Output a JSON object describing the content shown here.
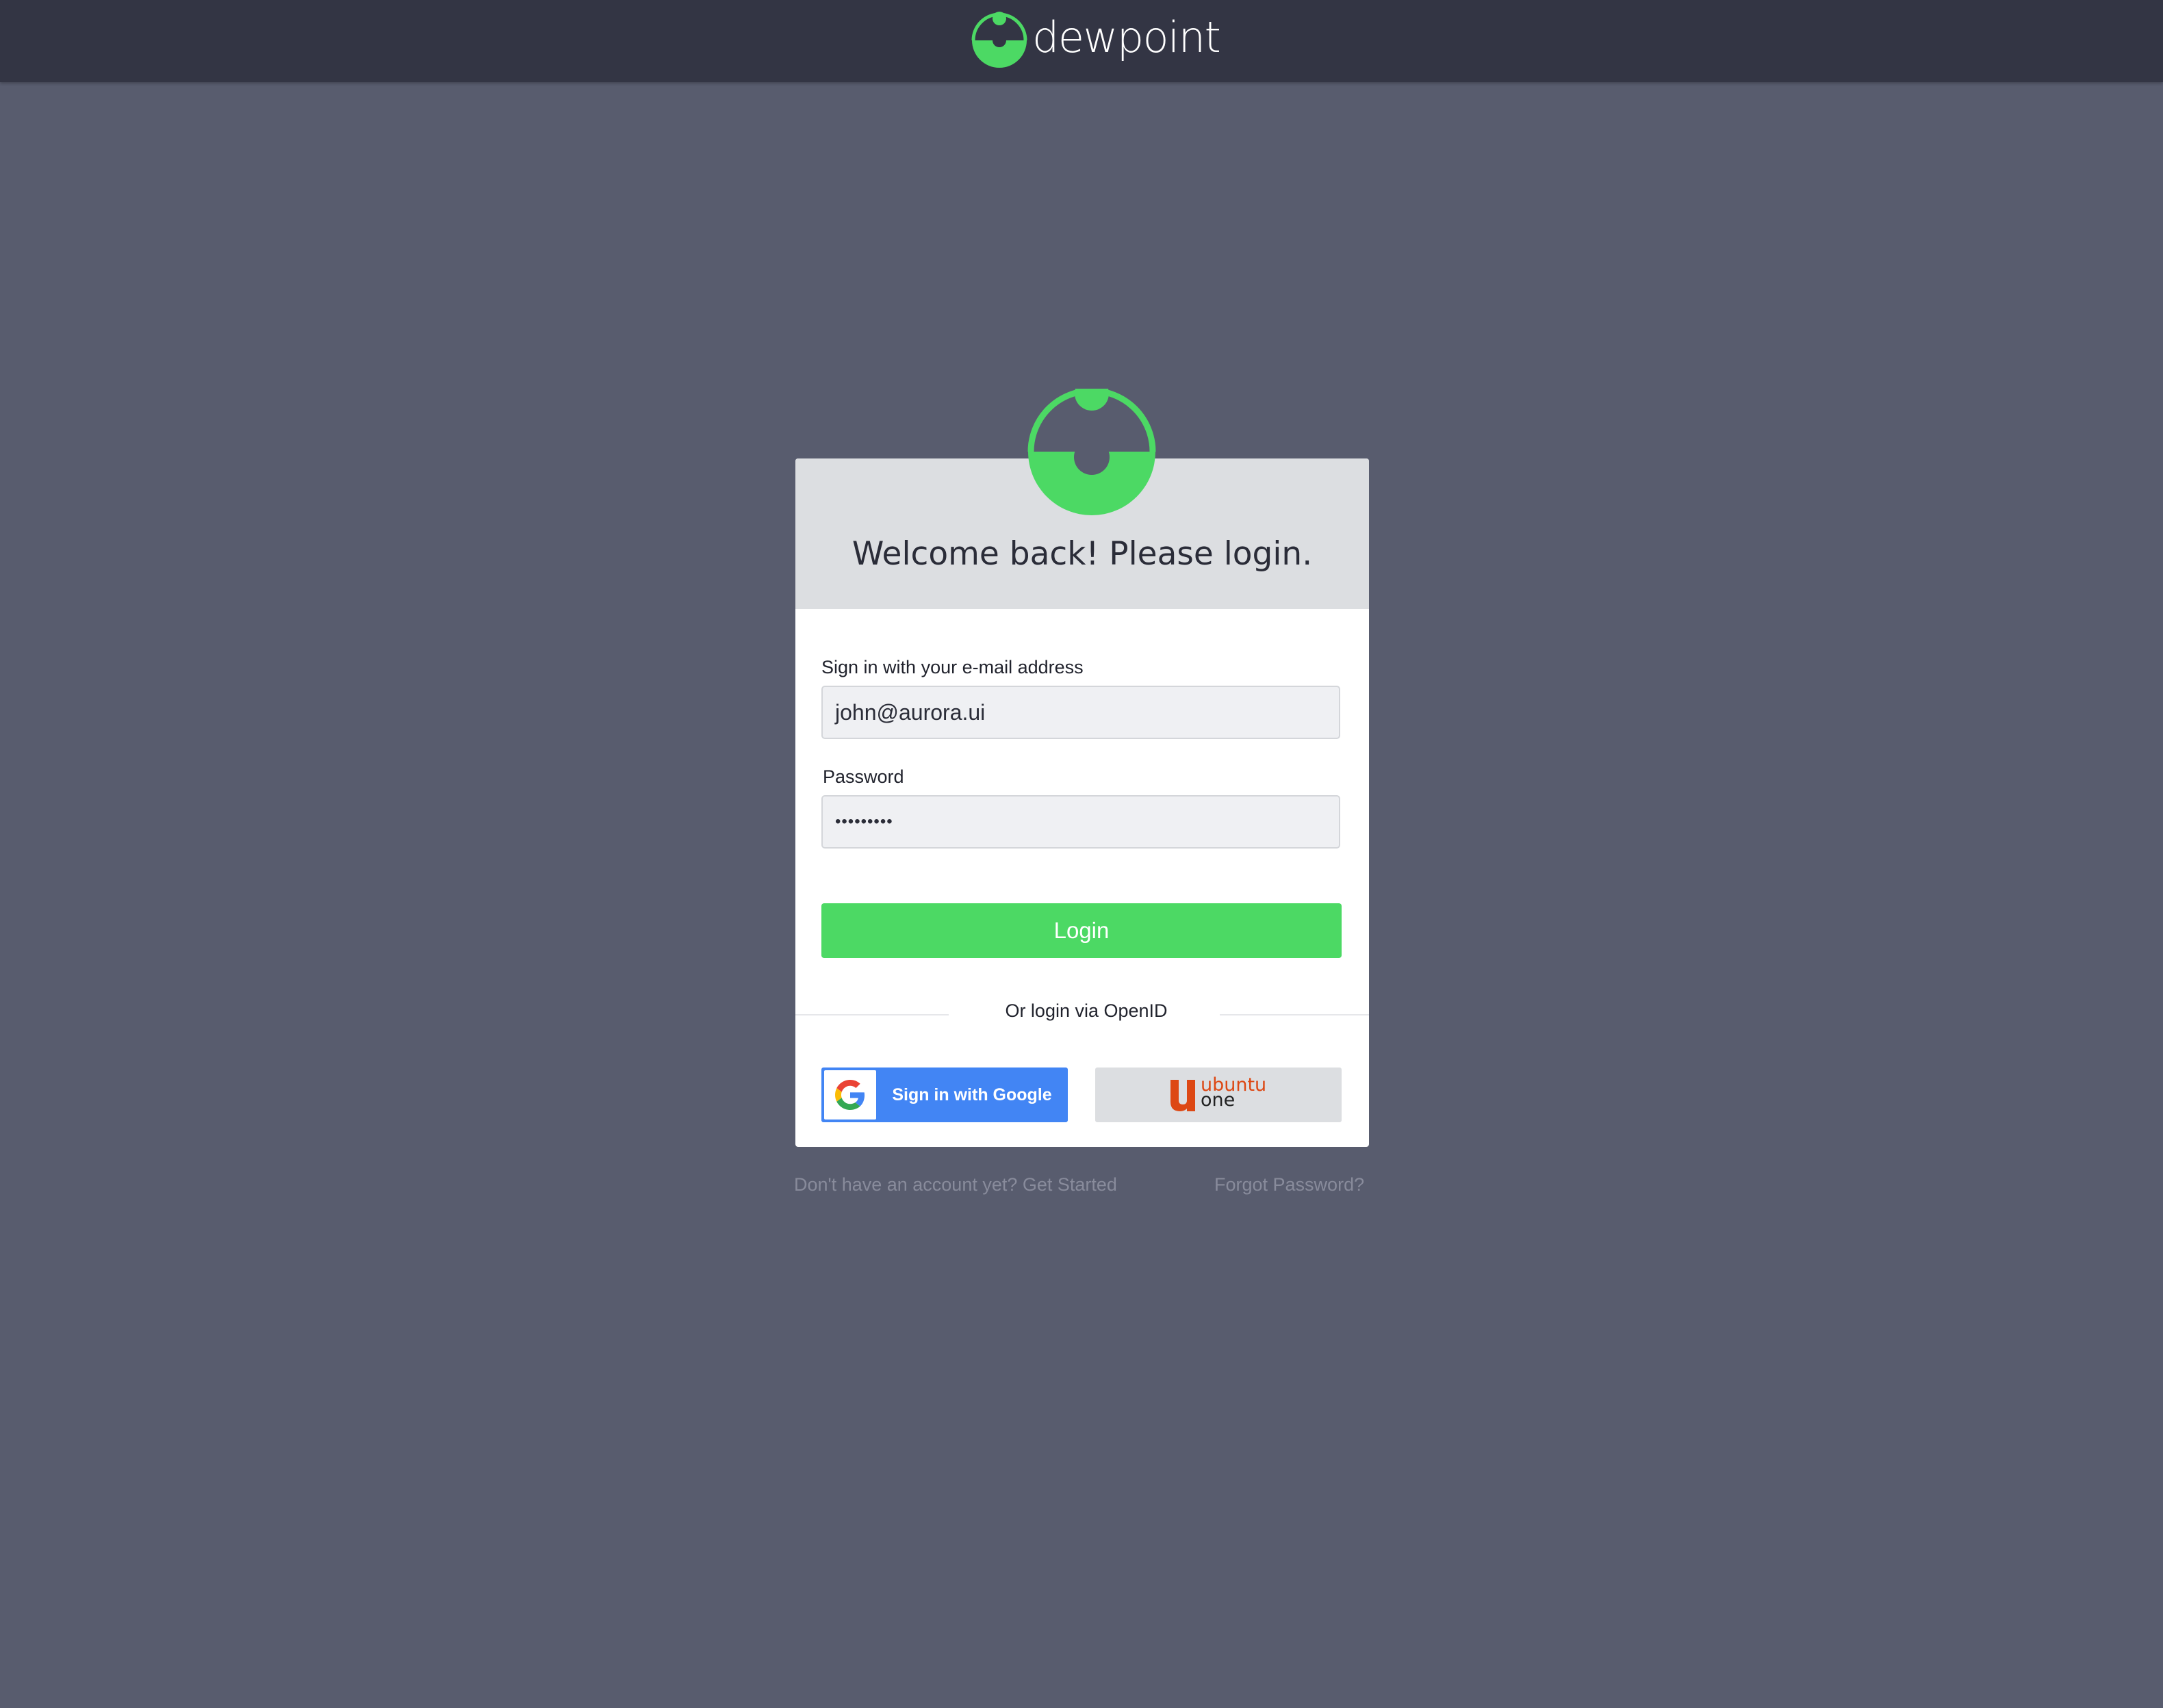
{
  "brand": {
    "name": "dewpoint",
    "accent_color": "#4cd964"
  },
  "login_card": {
    "title": "Welcome back! Please login.",
    "email_label": "Sign in with your e-mail address",
    "email_value": "john@aurora.ui",
    "password_label": "Password",
    "password_value": "•••••••••",
    "login_button": "Login",
    "openid_divider": "Or login via OpenID",
    "google_button": "Sign in with Google",
    "ubuntu_button": {
      "word": "ubuntu",
      "sub": "one"
    }
  },
  "footer": {
    "signup_link": "Don't have an account yet? Get Started",
    "forgot_link": "Forgot Password?"
  }
}
